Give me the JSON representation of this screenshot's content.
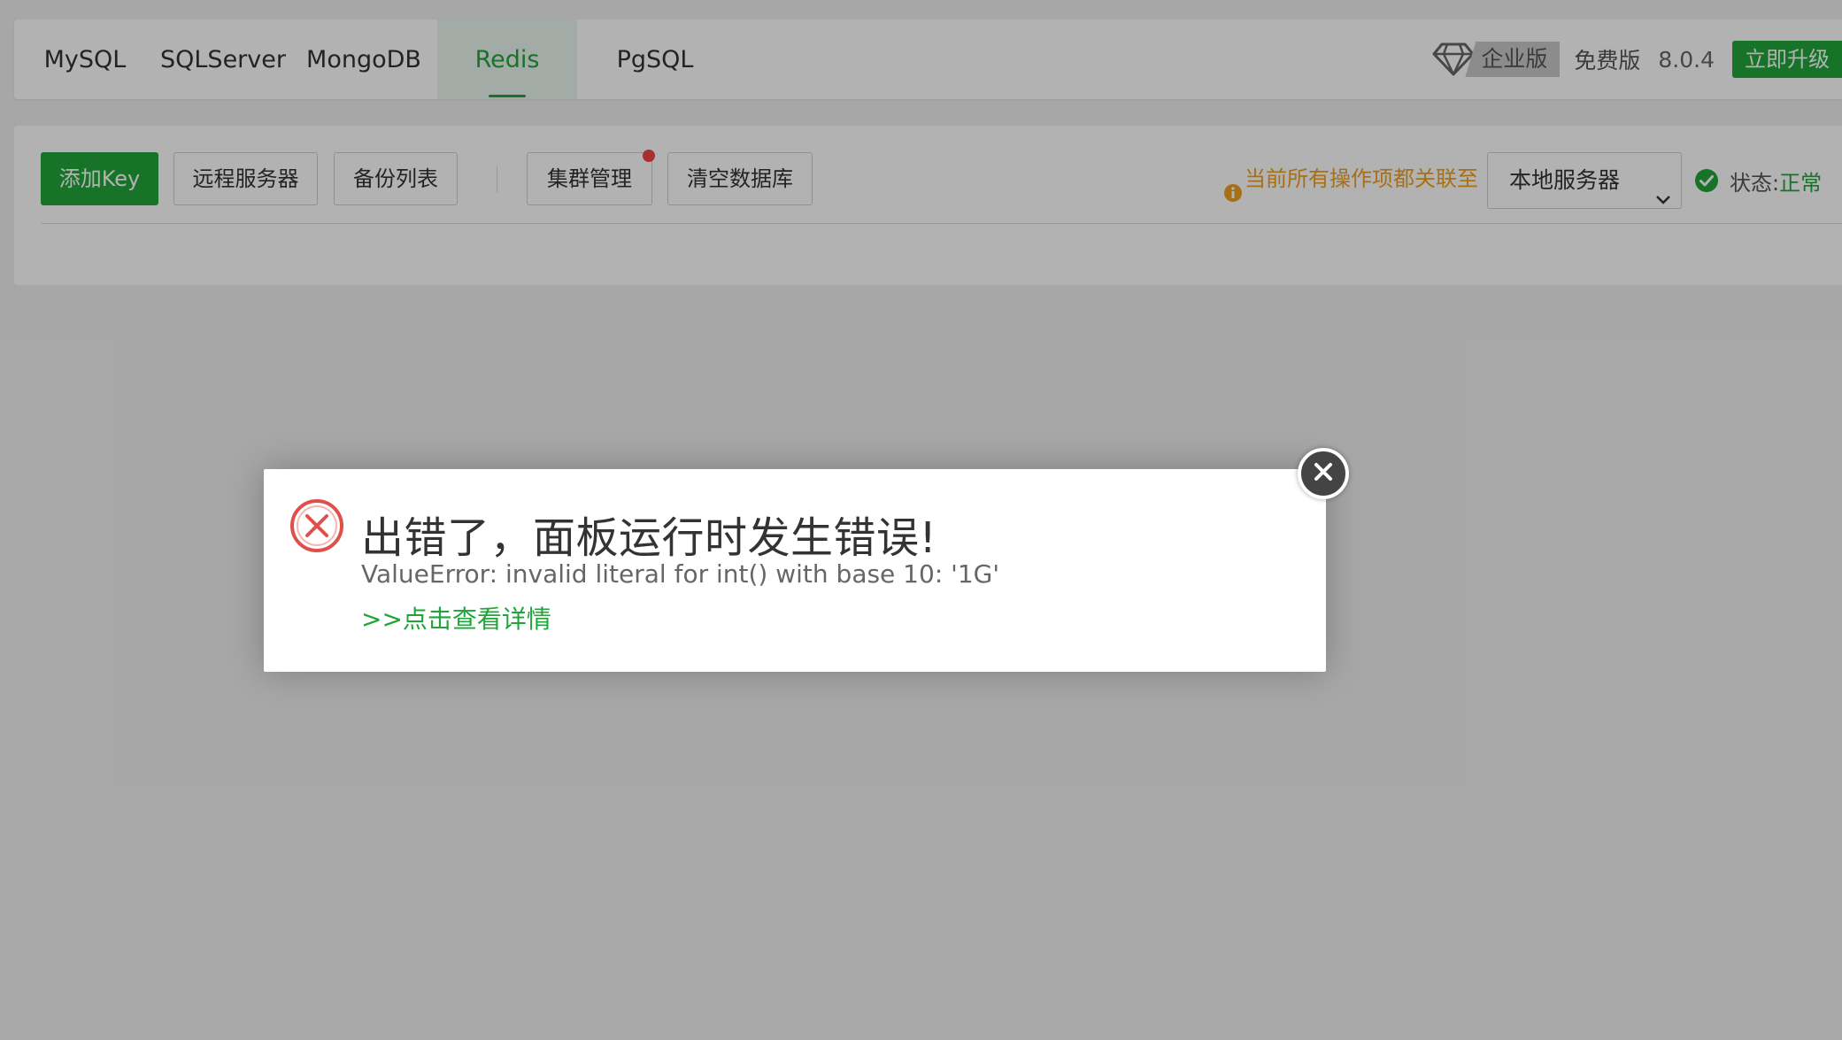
{
  "db_tabs": [
    {
      "label": "MySQL"
    },
    {
      "label": "SQLServer"
    },
    {
      "label": "MongoDB"
    },
    {
      "label": "Redis",
      "active": true
    },
    {
      "label": "PgSQL"
    }
  ],
  "header": {
    "enterprise_label": "企业版",
    "free_label": "免费版",
    "version": "8.0.4",
    "upgrade_label": "立即升级"
  },
  "toolbar": {
    "add_key_label": "添加Key",
    "remote_server_label": "远程服务器",
    "backup_list_label": "备份列表",
    "cluster_label": "集群管理",
    "clear_db_label": "清空数据库",
    "tip_text": "当前所有操作项都关联至",
    "server_select_value": "本地服务器",
    "status_label": "状态:",
    "status_value": "正常"
  },
  "dialog": {
    "title": "出错了，面板运行时发生错误!",
    "message": "ValueError: invalid literal for int() with base 10: '1G'",
    "details_link": ">>点击查看详情"
  },
  "colors": {
    "brand_green": "#20a53a",
    "warning_orange": "#f0a020",
    "error_red": "#ef4444"
  },
  "icons": [
    "diamond-icon",
    "info-icon",
    "chevron-down-icon",
    "check-circle-icon",
    "error-circle-icon",
    "close-icon"
  ]
}
